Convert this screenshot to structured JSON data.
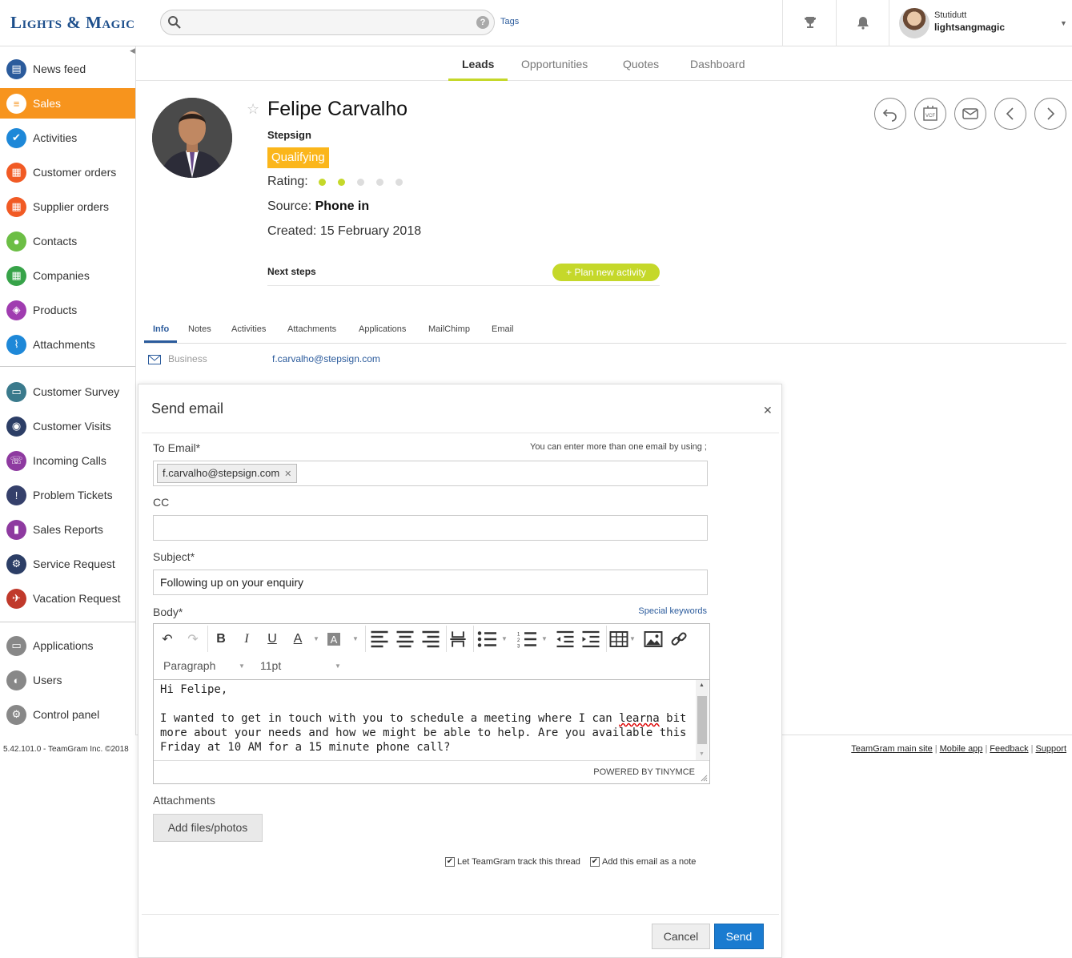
{
  "brand": {
    "logo_text": "Lights & Magic"
  },
  "topbar": {
    "search_placeholder": "",
    "tags_link": "Tags",
    "user_name": "Stutidutt",
    "user_account": "lightsangmagic"
  },
  "sidebar": {
    "items": [
      {
        "label": "News feed",
        "icon": "news-feed-icon",
        "color": "#2b5b9c"
      },
      {
        "label": "Sales",
        "icon": "sales-icon",
        "color": "#f7941d",
        "active": true
      },
      {
        "label": "Activities",
        "icon": "activities-icon",
        "color": "#1e88d8"
      },
      {
        "label": "Customer orders",
        "icon": "customer-orders-icon",
        "color": "#f15a24"
      },
      {
        "label": "Supplier orders",
        "icon": "supplier-orders-icon",
        "color": "#f15a24"
      },
      {
        "label": "Contacts",
        "icon": "contacts-icon",
        "color": "#6cbe45"
      },
      {
        "label": "Companies",
        "icon": "companies-icon",
        "color": "#37a349"
      },
      {
        "label": "Products",
        "icon": "products-icon",
        "color": "#a03cb0"
      },
      {
        "label": "Attachments",
        "icon": "attachments-icon",
        "color": "#1e88d8"
      }
    ],
    "apps": [
      {
        "label": "Customer Survey",
        "icon": "customer-survey-icon",
        "color": "#3a7a8c"
      },
      {
        "label": "Customer Visits",
        "icon": "customer-visits-icon",
        "color": "#2c3e66"
      },
      {
        "label": "Incoming Calls",
        "icon": "incoming-calls-icon",
        "color": "#8e3aa0"
      },
      {
        "label": "Problem Tickets",
        "icon": "problem-tickets-icon",
        "color": "#35406b"
      },
      {
        "label": "Sales Reports",
        "icon": "sales-reports-icon",
        "color": "#8e3aa0"
      },
      {
        "label": "Service Request",
        "icon": "service-request-icon",
        "color": "#2c3e66"
      },
      {
        "label": "Vacation Request",
        "icon": "vacation-request-icon",
        "color": "#c0392b"
      }
    ],
    "admin": [
      {
        "label": "Applications",
        "icon": "applications-icon",
        "color": "#888888"
      },
      {
        "label": "Users",
        "icon": "users-icon",
        "color": "#888888"
      },
      {
        "label": "Control panel",
        "icon": "control-panel-icon",
        "color": "#888888"
      }
    ],
    "version": "5.42.101.0 - TeamGram Inc. ©2018"
  },
  "main_tabs": [
    "Leads",
    "Opportunities",
    "Quotes",
    "Dashboard"
  ],
  "lead": {
    "name": "Felipe Carvalho",
    "company": "Stepsign",
    "status": "Qualifying",
    "rating_label": "Rating:",
    "rating": 2,
    "rating_max": 5,
    "source_label": "Source:",
    "source_value": "Phone in",
    "created": "Created: 15 February 2018",
    "next_steps_label": "Next steps",
    "plan_activity": "+ Plan new activity"
  },
  "detail_tabs": [
    "Info",
    "Notes",
    "Activities",
    "Attachments",
    "Applications",
    "MailChimp",
    "Email"
  ],
  "info": {
    "business_label": "Business",
    "business_email": "f.carvalho@stepsign.com"
  },
  "footer": {
    "links": [
      "TeamGram main site",
      "Mobile app",
      "Feedback",
      "Support"
    ]
  },
  "modal": {
    "title": "Send email",
    "to_label": "To Email*",
    "to_hint": "You can enter more than one email by using ;",
    "to_chip": "f.carvalho@stepsign.com",
    "cc_label": "CC",
    "cc_value": "",
    "subject_label": "Subject*",
    "subject_value": "Following up on your enquiry",
    "body_label": "Body*",
    "special_keywords": "Special keywords",
    "format_block": "Paragraph",
    "font_size": "11pt",
    "body_greeting": "Hi Felipe,",
    "body_text_1": "I wanted to get in touch with you to schedule a meeting where I can ",
    "body_misspelled": "learna",
    "body_text_2": " bit more about your needs and how we might be able to help. Are you available this Friday at 10 AM for a 15 minute phone call?",
    "powered_by": "POWERED BY TINYMCE",
    "attachments_label": "Attachments",
    "add_files": "Add files/photos",
    "track_label": "Let TeamGram track this thread",
    "note_label": "Add this email as a note",
    "cancel": "Cancel",
    "send": "Send"
  },
  "colors": {
    "accent": "#f7941d",
    "lime": "#c5d82a",
    "status": "#fbb61b",
    "primary": "#1a7bd0",
    "link": "#2b5b9c"
  }
}
